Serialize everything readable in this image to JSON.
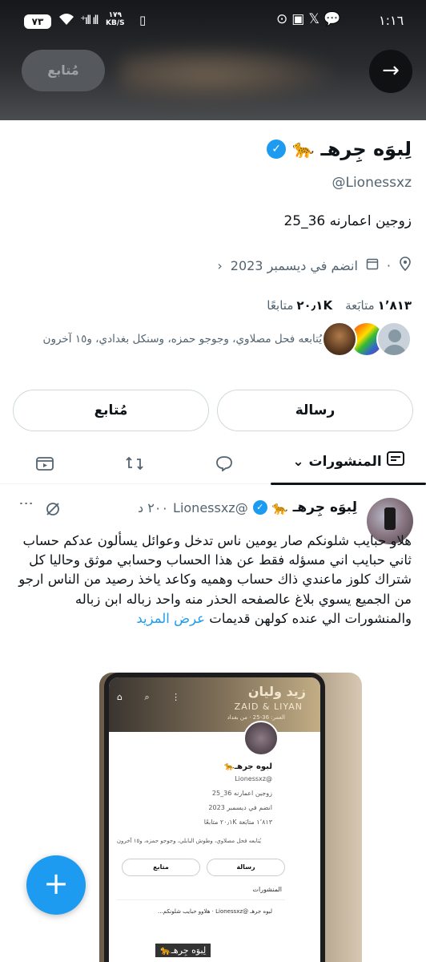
{
  "status_bar": {
    "battery": "٧٣",
    "signal": "⁺ıll ıll",
    "speed_value": "١٧٩",
    "speed_unit": "KB/S",
    "time": "١:١٦"
  },
  "header": {
    "follow_label": "مُتابع",
    "back_icon": "arrow-right-icon"
  },
  "profile": {
    "name": "لِبوَه جِرهـ",
    "emoji": "🐆",
    "handle": "@Lionessxz",
    "bio": "زوجين اعمارنه 36_25",
    "location_dot": "·",
    "joined": "انضم في ديسمبر 2023",
    "following_count": "١٬٨١٣",
    "following_label": "متابَعة",
    "followers_count": "٢٠٫١K",
    "followers_label": "متابعًا",
    "followed_by": "يُتابعه فحل مصلاوي، وجوجو حمزه، وسنكل بغدادي، و١٥ آخرون",
    "message_label": "رسالة",
    "follow_label": "مُتابع"
  },
  "tabs": {
    "posts_label": "المنشورات"
  },
  "tweet": {
    "name": "لِبوَه جِرهـ",
    "emoji": "🐆",
    "handle": "@Lionessxz",
    "time": "٢٠٠ د",
    "text": "هلاو حبايب شلونكم صار يومين ناس تدخل وعوائل يسألون عدكم حساب ثاني حبايب اني مسؤله فقط عن هذا الحساب وحسابي موثق وحاليا كل شتراك كلوز ماعندي ذاك حساب وهميه وكاعد ياخذ رصيد من الناس ارجو من الجميع يسوي بلاغ عالصفحه الحذر منه واحد زباله ابن زباله والمنشورات الي عنده كولهن قديمات",
    "show_more": "عرض المزيد"
  },
  "media": {
    "banner_title": "زيد وليان",
    "banner_sub": "ZAID & LIYAN",
    "banner_age": "العمر: 36-25 · من بغداد",
    "name": "لبوه جرهـ🐆",
    "handle": "@Lionessxz",
    "bio": "زوجين اعمارنه 36_25",
    "joined": "انضم في ديسمبر 2023",
    "stats": "١٬٨١٣ متابَعة  ٢٠٫١K متابعًا",
    "followed_by": "يُتابعه فحل مصلاوي، وطوش البابلي، وجوجو حمزه، و١٥ آخرون",
    "message_label": "رسالة",
    "follow_label": "متابع",
    "posts_label": "المنشورات",
    "tweet_preview": "لبوه جرهـ @Lionessxz · هلاوو حبايب شلونكم...",
    "caption": "لِبوَه جِرهـ🐆"
  }
}
